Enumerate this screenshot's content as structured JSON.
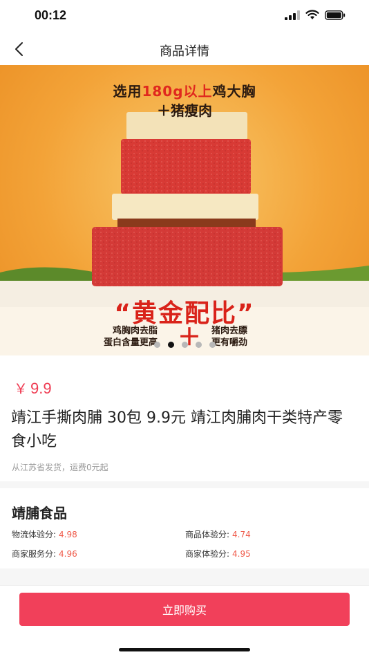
{
  "status_bar": {
    "time": "00:12"
  },
  "nav": {
    "title": "商品详情"
  },
  "banner": {
    "line1_pre": "选用",
    "line1_highlight": "180g以上",
    "line1_post": "鸡大胸",
    "line2": "＋猪瘦肉",
    "slogan": "“黄金配比”",
    "left_note_1": "鸡胸肉去脂",
    "left_note_2": "蛋白含量更高",
    "plus": "＋",
    "right_note_1": "猪肉去膘",
    "right_note_2": "更有嚼劲",
    "dots_total": 5,
    "active_dot": 2
  },
  "product": {
    "currency": "￥",
    "price": "9.9",
    "title": "靖江手撕肉脯 30包 9.9元 靖江肉脯肉干类特产零食小吃",
    "shipping": "从江苏省发货，运费0元起"
  },
  "shop": {
    "name": "靖脯食品",
    "scores": [
      {
        "label": "物流体验分:",
        "value": "4.98"
      },
      {
        "label": "商品体验分:",
        "value": "4.74"
      },
      {
        "label": "商家服务分:",
        "value": "4.96"
      },
      {
        "label": "商家体验分:",
        "value": "4.95"
      }
    ]
  },
  "actions": {
    "buy_label": "立即购买"
  },
  "colors": {
    "accent": "#f1405a",
    "price": "#ef3b52",
    "score": "#ef5a4a"
  },
  "icons": [
    "signal-icon",
    "wifi-icon",
    "battery-icon",
    "back-arrow-icon"
  ]
}
